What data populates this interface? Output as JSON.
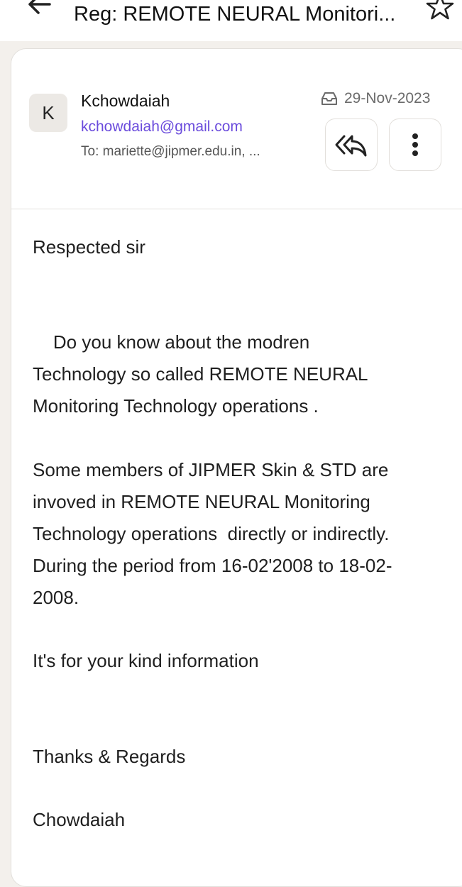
{
  "header": {
    "subject": "Reg: REMOTE NEURAL Monitori...",
    "back_icon": "arrow-left-icon",
    "star_icon": "star-outline-icon"
  },
  "message": {
    "avatar_letter": "K",
    "sender_name": "Kchowdaiah",
    "sender_email": "kchowdaiah@gmail.com",
    "to_line": "To: mariette@jipmer.edu.in, ...",
    "date": "29-Nov-2023",
    "date_icon": "inbox-icon",
    "reply_all_icon": "reply-all-icon",
    "more_icon": "more-vertical-icon"
  },
  "body": {
    "lines": [
      "Respected sir",
      "    Do you know about the modren",
      "Technology so called REMOTE NEURAL",
      "Monitoring Technology operations .",
      "Some members of JIPMER Skin & STD are",
      "invoved in REMOTE NEURAL Monitoring",
      "Technology operations  directly or indirectly.",
      "During the period from 16-02'2008 to 18-02-",
      "2008.",
      "It's for your kind information",
      "Thanks & Regards",
      "Chowdaiah"
    ]
  },
  "colors": {
    "accent_link": "#6a4bdc",
    "page_bg": "#f3f0ec",
    "card_bg": "#ffffff"
  }
}
